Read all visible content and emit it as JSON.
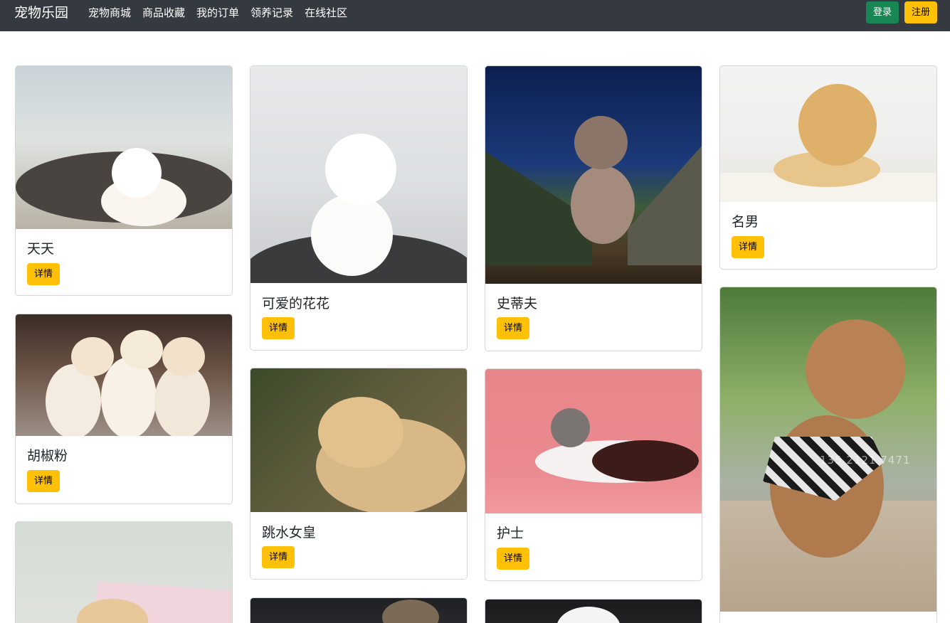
{
  "nav": {
    "brand": "宠物乐园",
    "links": [
      "宠物商城",
      "商品收藏",
      "我的订单",
      "领养记录",
      "在线社区"
    ],
    "login": "登录",
    "register": "注册"
  },
  "detail_label": "详情",
  "pets": [
    {
      "name": "天天"
    },
    {
      "name": "胡椒粉"
    },
    {
      "name": "可爱的花花"
    },
    {
      "name": "跳水女皇"
    },
    {
      "name": "史蒂夫"
    },
    {
      "name": "护士"
    },
    {
      "name": "名男"
    }
  ],
  "photos": {
    "poodle_watermark": "135 2121 7471"
  },
  "colors": {
    "navbar": "#343a40",
    "login": "#198754",
    "accent": "#ffc107"
  }
}
